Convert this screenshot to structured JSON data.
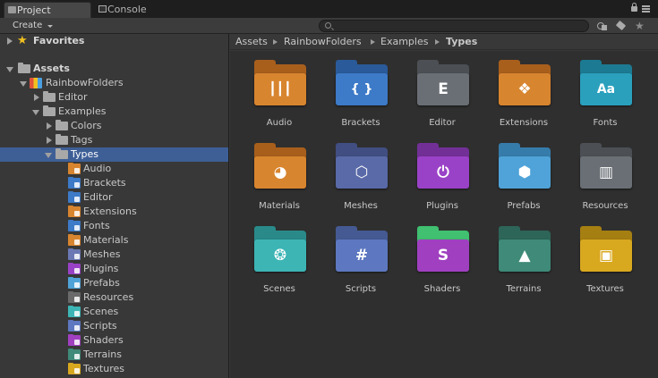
{
  "tabs": [
    {
      "label": "Project",
      "icon": "project-icon"
    },
    {
      "label": "Console",
      "icon": "console-icon"
    }
  ],
  "toolbar": {
    "create_label": "Create",
    "search_placeholder": ""
  },
  "tree": {
    "favorites_label": "Favorites",
    "assets_label": "Assets",
    "rainbow_label": "RainbowFolders",
    "editor_label": "Editor",
    "examples_label": "Examples",
    "colors_label": "Colors",
    "tags_label": "Tags",
    "types_label": "Types",
    "children": [
      {
        "label": "Audio",
        "color": "#d8852f",
        "glyph": "audio-wave-icon"
      },
      {
        "label": "Brackets",
        "color": "#3d7ac7",
        "glyph": "brackets-icon"
      },
      {
        "label": "Editor",
        "color": "#3d7ac7",
        "glyph": "editor-icon"
      },
      {
        "label": "Extensions",
        "color": "#d8852f",
        "glyph": "extensions-icon"
      },
      {
        "label": "Fonts",
        "color": "#3d7ac7",
        "glyph": "fonts-icon"
      },
      {
        "label": "Materials",
        "color": "#d8852f",
        "glyph": "materials-icon"
      },
      {
        "label": "Meshes",
        "color": "#6b78b3",
        "glyph": "meshes-icon"
      },
      {
        "label": "Plugins",
        "color": "#9a42c7",
        "glyph": "plugins-icon"
      },
      {
        "label": "Prefabs",
        "color": "#4fa3d8",
        "glyph": "prefabs-icon"
      },
      {
        "label": "Resources",
        "color": "#6a6a6a",
        "glyph": "resources-icon"
      },
      {
        "label": "Scenes",
        "color": "#3db5b5",
        "glyph": "scenes-icon"
      },
      {
        "label": "Scripts",
        "color": "#5d78c0",
        "glyph": "scripts-icon"
      },
      {
        "label": "Shaders",
        "color": "#a040c0",
        "glyph": "shaders-icon"
      },
      {
        "label": "Terrains",
        "color": "#3f8a78",
        "glyph": "terrains-icon"
      },
      {
        "label": "Textures",
        "color": "#d8a81f",
        "glyph": "textures-icon"
      }
    ]
  },
  "breadcrumb": [
    "Assets",
    "RainbowFolders",
    "Examples",
    "Types"
  ],
  "grid": [
    {
      "label": "Audio",
      "color": "#d8852f",
      "dark": "#a85f1c",
      "glyph": "┃┃┃",
      "icon": "audio-wave-icon"
    },
    {
      "label": "Brackets",
      "color": "#3d7ac7",
      "dark": "#2a5a9a",
      "glyph": "{ }",
      "icon": "brackets-icon"
    },
    {
      "label": "Editor",
      "color": "#6a6f75",
      "dark": "#4c5055",
      "glyph": "E",
      "icon": "editor-icon"
    },
    {
      "label": "Extensions",
      "color": "#d8852f",
      "dark": "#a85f1c",
      "glyph": "❖",
      "icon": "extensions-icon"
    },
    {
      "label": "Fonts",
      "color": "#2aa0bd",
      "dark": "#1c7a92",
      "glyph": "Aa",
      "icon": "fonts-icon"
    },
    {
      "label": "Materials",
      "color": "#d8852f",
      "dark": "#a85f1c",
      "glyph": "◕",
      "icon": "materials-icon"
    },
    {
      "label": "Meshes",
      "color": "#5a6aa8",
      "dark": "#414e82",
      "glyph": "⬡",
      "icon": "meshes-icon"
    },
    {
      "label": "Plugins",
      "color": "#9a42c7",
      "dark": "#723097",
      "glyph": "⏻",
      "icon": "plugins-icon"
    },
    {
      "label": "Prefabs",
      "color": "#4fa3d8",
      "dark": "#367cab",
      "glyph": "⬢",
      "icon": "prefabs-icon"
    },
    {
      "label": "Resources",
      "color": "#6a6f75",
      "dark": "#4c5055",
      "glyph": "▥",
      "icon": "resources-icon"
    },
    {
      "label": "Scenes",
      "color": "#3db5b5",
      "dark": "#2a8a8a",
      "glyph": "❂",
      "icon": "scenes-icon"
    },
    {
      "label": "Scripts",
      "color": "#5d78c0",
      "dark": "#455a93",
      "glyph": "#",
      "icon": "scripts-icon"
    },
    {
      "label": "Shaders",
      "color": "#a040c0",
      "dark": "#40c070",
      "glyph": "S",
      "icon": "shaders-icon"
    },
    {
      "label": "Terrains",
      "color": "#3f8a78",
      "dark": "#2d6558",
      "glyph": "▲",
      "icon": "terrains-icon"
    },
    {
      "label": "Textures",
      "color": "#d8a81f",
      "dark": "#a67f12",
      "glyph": "▣",
      "icon": "textures-icon"
    }
  ],
  "colors": {
    "selection": "#3e5f96",
    "panel": "#383838",
    "grid_bg": "#2f2f2f"
  }
}
